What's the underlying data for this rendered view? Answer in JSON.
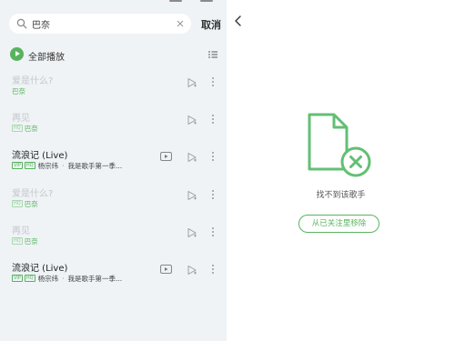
{
  "search": {
    "query": "巴奈",
    "cancel_label": "取消"
  },
  "play_all": {
    "label": "全部播放"
  },
  "songs": [
    {
      "title": "爱是什么?",
      "subtitle": "巴奈",
      "badges": []
    },
    {
      "title": "再见",
      "subtitle": "巴奈",
      "badges": [
        "HQ"
      ]
    },
    {
      "title": "流浪记 (Live)",
      "artist": "杨宗纬",
      "desc": "我是歌手第一季...",
      "badges": [
        "VIP",
        "HQ"
      ]
    },
    {
      "title": "爱是什么?",
      "subtitle": "巴奈",
      "badges": [
        "HQ"
      ]
    },
    {
      "title": "再见",
      "subtitle": "巴奈",
      "badges": [
        "HQ"
      ]
    },
    {
      "title": "流浪记 (Live)",
      "artist": "杨宗纬",
      "desc": "我是歌手第一季...",
      "badges": [
        "VIP",
        "HQ"
      ]
    }
  ],
  "right": {
    "empty_text": "找不到该歌手",
    "unfollow_label": "从已关注里移除"
  },
  "colors": {
    "accent": "#58b35e",
    "panel_bg": "#eff3f6"
  },
  "icons": [
    "search-icon",
    "clear-icon",
    "play-icon",
    "list-icon",
    "video-icon",
    "next-play-icon",
    "more-icon",
    "back-icon",
    "file-not-found-icon"
  ]
}
